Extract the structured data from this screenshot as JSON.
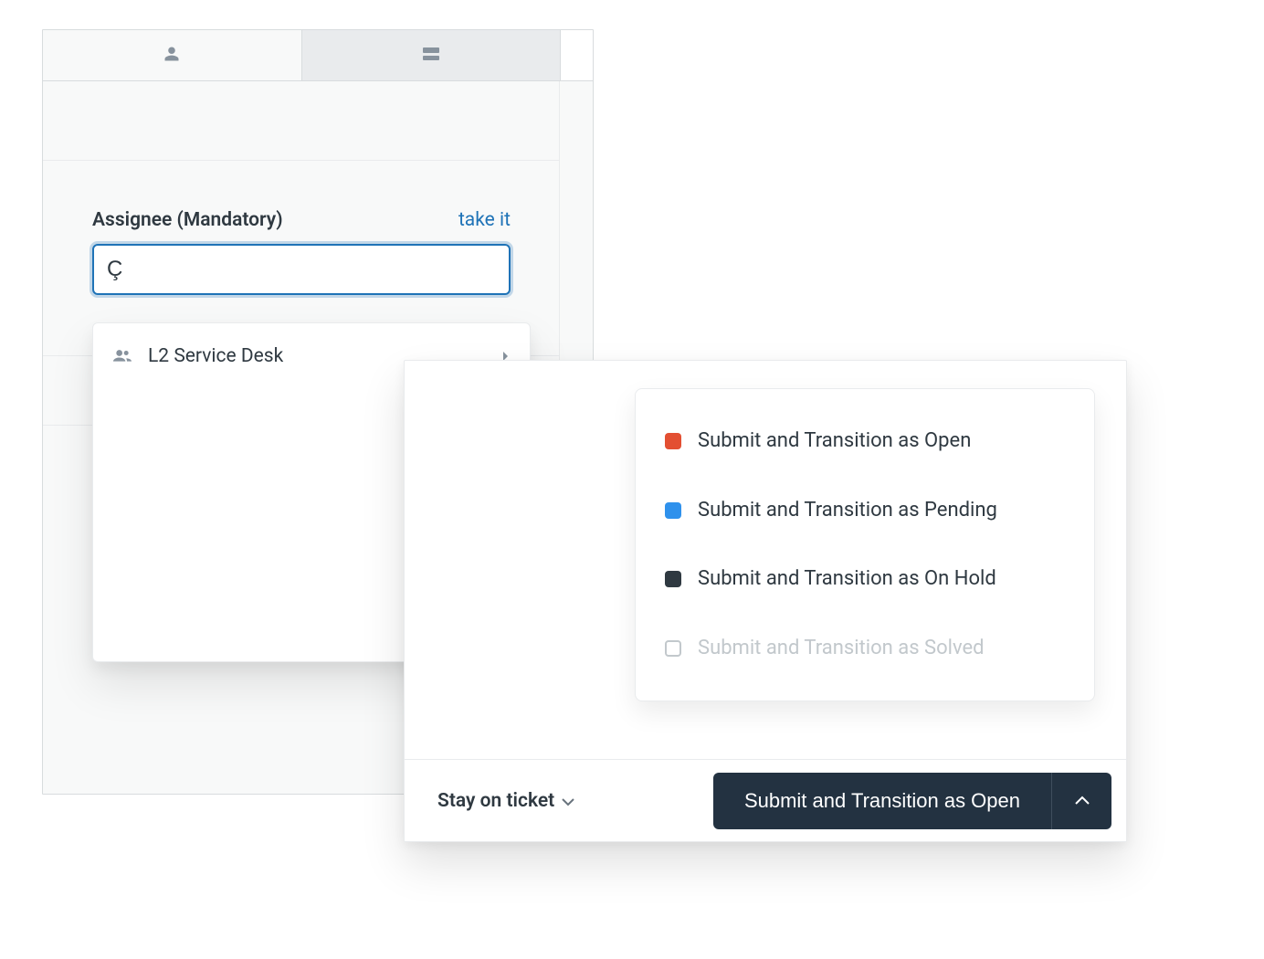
{
  "tabs": {
    "person_icon": "person-icon",
    "panel_icon": "panel-icon"
  },
  "assignee": {
    "label": "Assignee (Mandatory)",
    "take_it": "take it",
    "input_value": "Ç",
    "dropdown": [
      {
        "label": "L2 Service Desk"
      }
    ]
  },
  "submit_menu": {
    "items": [
      {
        "label": "Submit and Transition as Open",
        "color": "#e34f32",
        "disabled": false
      },
      {
        "label": "Submit and Transition as Pending",
        "color": "#2f91ec",
        "disabled": false
      },
      {
        "label": "Submit and Transition as On Hold",
        "color": "#2f3941",
        "disabled": false
      },
      {
        "label": "Submit and Transition as Solved",
        "color": "",
        "disabled": true
      }
    ]
  },
  "footer": {
    "stay_label": "Stay on ticket",
    "submit_label": "Submit and Transition as Open"
  }
}
